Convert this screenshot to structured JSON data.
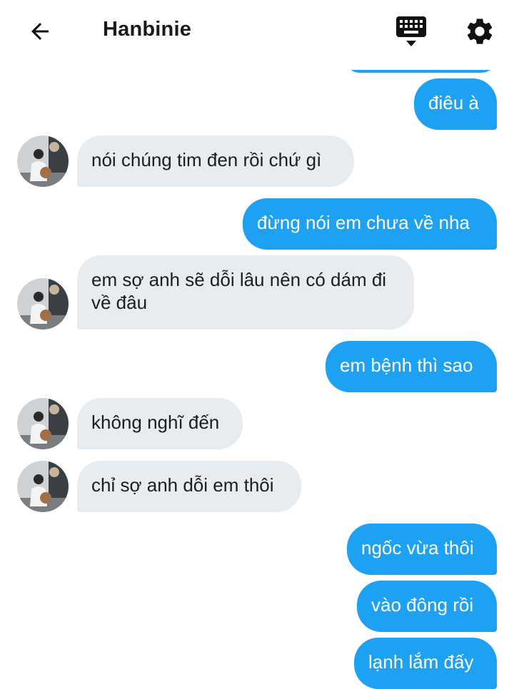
{
  "header": {
    "title": "Hanbinie",
    "back_icon": "arrow-left-icon",
    "keyboard_icon": "keyboard-icon",
    "settings_icon": "gear-icon"
  },
  "colors": {
    "sent_bubble": "#1da1f2",
    "received_bubble": "#e6ecf0",
    "sent_text": "#ffffff",
    "received_text": "#1c1e21"
  },
  "messages": [
    {
      "from": "me",
      "text": "điêu à"
    },
    {
      "from": "them",
      "text": "nói chúng tim đen rồi chứ gì"
    },
    {
      "from": "me",
      "text": "đừng nói em chưa về nha"
    },
    {
      "from": "them",
      "text": "em sợ anh sẽ dỗi lâu nên có dám đi về đâu"
    },
    {
      "from": "me",
      "text": "em bệnh thì sao"
    },
    {
      "from": "them",
      "text": "không nghĩ đến"
    },
    {
      "from": "them",
      "text": "chỉ sợ anh dỗi em thôi"
    },
    {
      "from": "me",
      "text": "ngốc vừa thôi"
    },
    {
      "from": "me",
      "text": "vào đông rồi"
    },
    {
      "from": "me",
      "text": "lạnh lắm đấy"
    }
  ]
}
